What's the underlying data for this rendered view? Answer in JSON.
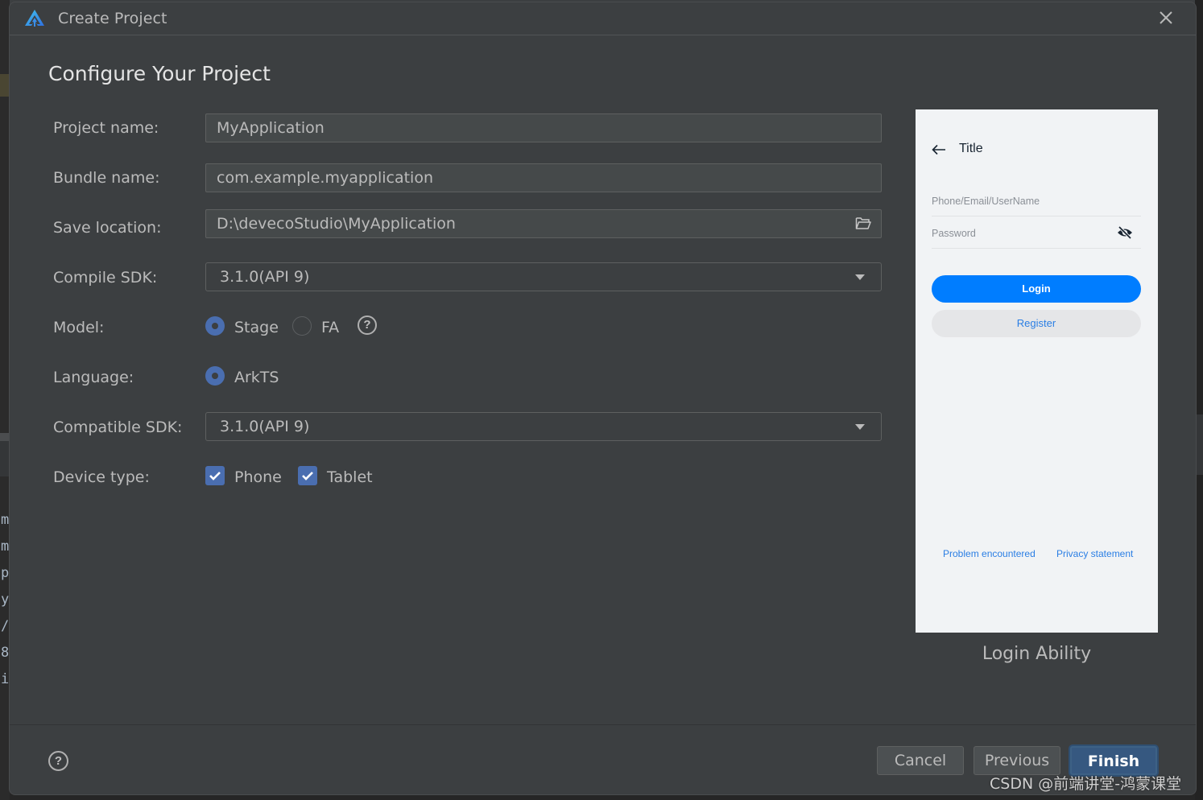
{
  "dialog": {
    "title": "Create Project",
    "heading": "Configure Your Project",
    "close_icon": "close-icon",
    "logo_icon": "deveco-logo-icon"
  },
  "form": {
    "project_name": {
      "label": "Project name:",
      "value": "MyApplication"
    },
    "bundle_name": {
      "label": "Bundle name:",
      "value": "com.example.myapplication"
    },
    "save_location": {
      "label": "Save location:",
      "value": "D:\\devecoStudio\\MyApplication",
      "icon": "folder-icon"
    },
    "compile_sdk": {
      "label": "Compile SDK:",
      "value": "3.1.0(API 9)"
    },
    "model": {
      "label": "Model:",
      "options": [
        {
          "label": "Stage",
          "selected": true
        },
        {
          "label": "FA",
          "selected": false
        }
      ],
      "help_icon": "question-circle-icon",
      "help_glyph": "?"
    },
    "language": {
      "label": "Language:",
      "options": [
        {
          "label": "ArkTS",
          "selected": true
        }
      ]
    },
    "compatible_sdk": {
      "label": "Compatible SDK:",
      "value": "3.1.0(API 9)"
    },
    "device_type": {
      "label": "Device type:",
      "options": [
        {
          "label": "Phone",
          "checked": true
        },
        {
          "label": "Tablet",
          "checked": true
        }
      ]
    }
  },
  "preview": {
    "title": "Title",
    "username_hint": "Phone/Email/UserName",
    "password_hint": "Password",
    "login_label": "Login",
    "register_label": "Register",
    "links": [
      "Problem encountered",
      "Privacy statement"
    ],
    "caption": "Login Ability",
    "colors": {
      "primary": "#007dff",
      "link": "#2a7ee4"
    }
  },
  "footer": {
    "help_glyph": "?",
    "cancel_label": "Cancel",
    "previous_label": "Previous",
    "finish_label": "Finish"
  },
  "background": {
    "code_chars": [
      "m",
      "m",
      "p",
      "y",
      "/",
      "8",
      "i"
    ]
  },
  "watermark": "CSDN @前端讲堂-鸿蒙课堂"
}
